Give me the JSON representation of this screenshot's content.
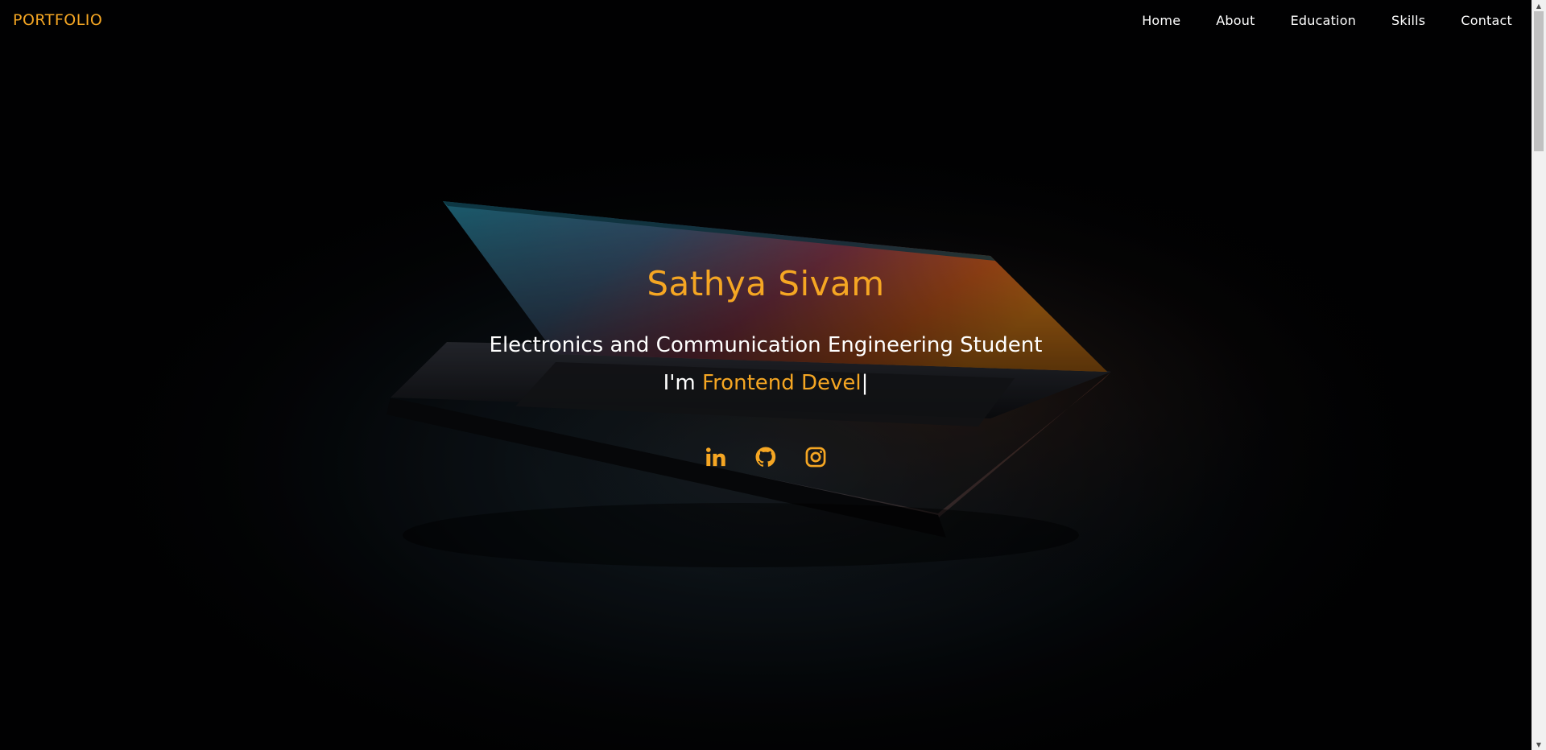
{
  "navbar": {
    "brand": "PORTFOLIO",
    "links": [
      "Home",
      "About",
      "Education",
      "Skills",
      "Contact"
    ]
  },
  "hero": {
    "name": "Sathya Sivam",
    "subtitle": "Electronics and Communication Engineering Student",
    "typed_prefix": "I'm ",
    "typed_text": "Frontend Devel",
    "cursor": "|",
    "social_icons": [
      "linkedin-icon",
      "github-icon",
      "instagram-icon"
    ]
  },
  "colors": {
    "accent": "#f5a623",
    "text": "#ffffff",
    "background": "#000000"
  }
}
